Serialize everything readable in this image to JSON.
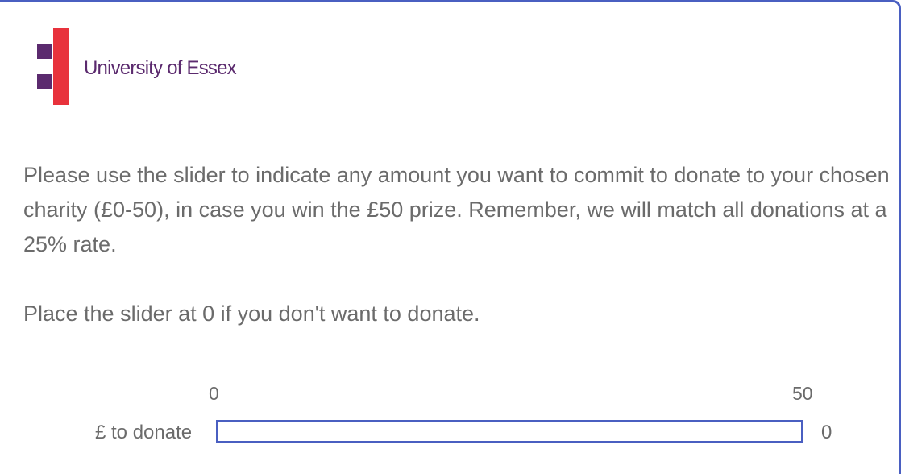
{
  "logo": {
    "text": "University of Essex",
    "colors": {
      "red": "#e8323c",
      "purple": "#5b2a6e"
    }
  },
  "question": {
    "paragraph1": "Please use the slider to indicate any amount you want to commit to donate to your chosen charity (£0-50), in case you win the £50 prize. Remember, we will match all donations at a 25% rate.",
    "paragraph2": "Place the slider at 0 if you don't want to donate."
  },
  "slider": {
    "min_label": "0",
    "max_label": "50",
    "label": "£ to donate",
    "value": "0",
    "min": 0,
    "max": 50,
    "current": 0,
    "accent_color": "#4a5fc1"
  }
}
